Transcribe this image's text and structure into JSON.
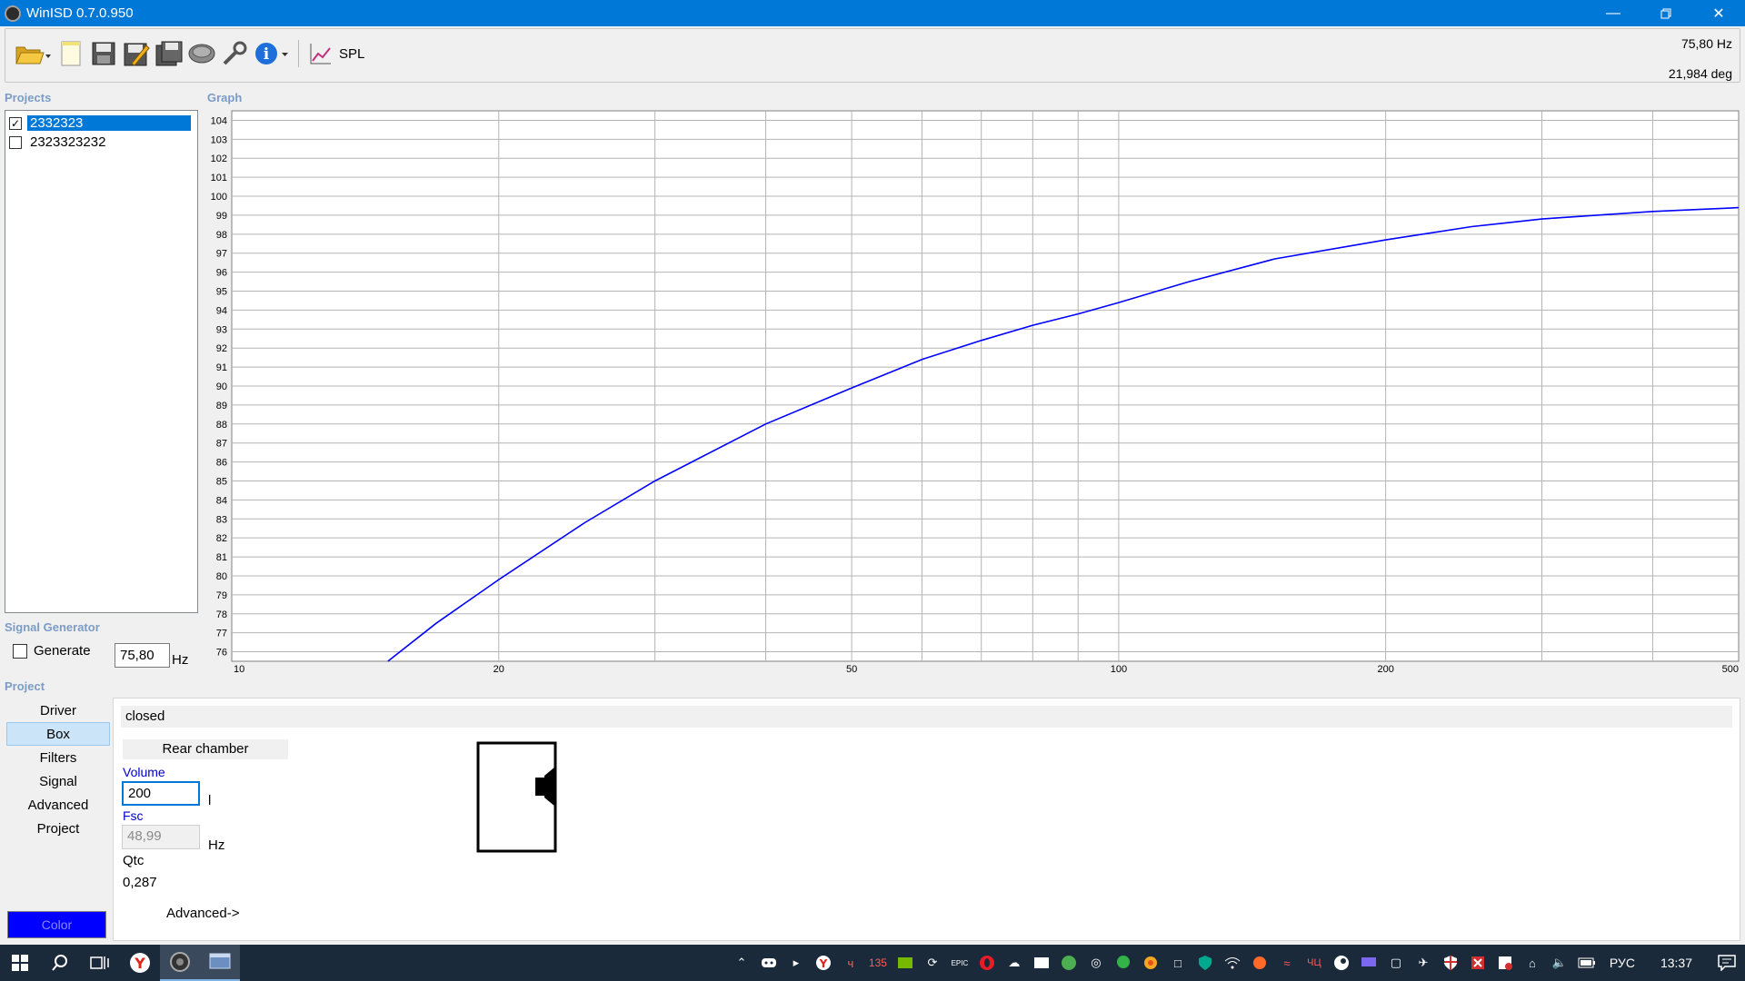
{
  "window": {
    "title": "WinISD 0.7.0.950"
  },
  "toolbar": {
    "buttons": [
      "open-icon",
      "new-icon",
      "save-icon",
      "save-as-icon",
      "save-all-icon",
      "driver-editor-icon",
      "tools-icon",
      "info-icon"
    ],
    "spl_label": "SPL",
    "readout_freq": "75,80 Hz",
    "readout_deg": "21,984 deg"
  },
  "projects": {
    "label": "Projects",
    "items": [
      {
        "name": "2332323",
        "checked": true,
        "selected": true
      },
      {
        "name": "2323323232",
        "checked": false,
        "selected": false
      }
    ]
  },
  "graph": {
    "label": "Graph"
  },
  "chart_data": {
    "type": "line",
    "xscale": "log",
    "xlim": [
      10,
      500
    ],
    "ylim": [
      75.5,
      104.5
    ],
    "x_ticks": [
      10,
      20,
      50,
      100,
      200,
      500
    ],
    "y_ticks": [
      76,
      77,
      78,
      79,
      80,
      81,
      82,
      83,
      84,
      85,
      86,
      87,
      88,
      89,
      90,
      91,
      92,
      93,
      94,
      95,
      96,
      97,
      98,
      99,
      100,
      101,
      102,
      103,
      104
    ],
    "grid": true,
    "series": [
      {
        "color": "#0000ff",
        "x": [
          15,
          17,
          20,
          25,
          30,
          40,
          50,
          60,
          70,
          80,
          90,
          100,
          120,
          150,
          200,
          250,
          300,
          400,
          500
        ],
        "y": [
          75.5,
          77.5,
          79.8,
          82.8,
          85.0,
          88.0,
          89.9,
          91.4,
          92.4,
          93.2,
          93.8,
          94.4,
          95.5,
          96.7,
          97.7,
          98.4,
          98.8,
          99.2,
          99.4
        ]
      }
    ]
  },
  "signal_generator": {
    "label": "Signal Generator",
    "generate_label": "Generate",
    "frequency": "75,80",
    "unit": "Hz"
  },
  "project_panel": {
    "label": "Project",
    "nav": [
      "Driver",
      "Box",
      "Filters",
      "Signal",
      "Advanced",
      "Project"
    ],
    "active": "Box",
    "color_button": "Color"
  },
  "box": {
    "type": "closed",
    "chamber_tab": "Rear chamber",
    "volume_label": "Volume",
    "volume_value": "200",
    "volume_unit": "l",
    "fsc_label": "Fsc",
    "fsc_value": "48,99",
    "fsc_unit": "Hz",
    "qtc_label": "Qtc",
    "qtc_value": "0,287",
    "advanced_link": "Advanced->"
  },
  "taskbar": {
    "language": "РУС",
    "time": "13:37",
    "tray_badge": "135"
  }
}
